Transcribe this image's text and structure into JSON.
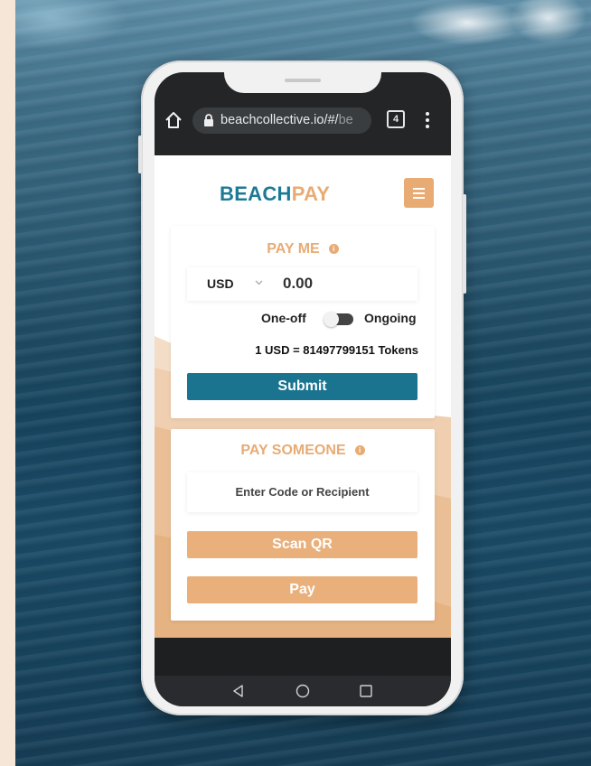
{
  "browser": {
    "url_main": "beachcollective.io/#/",
    "url_faded": "be",
    "tab_count": "4"
  },
  "app": {
    "logo_part1": "BEACH",
    "logo_part2": "PAY"
  },
  "pay_me": {
    "title": "PAY ME",
    "currency": "USD",
    "amount": "0.00",
    "toggle_left": "One-off",
    "toggle_right": "Ongoing",
    "toggle_state": "ongoing",
    "rate": "1 USD = 81497799151 Tokens",
    "submit_label": "Submit"
  },
  "pay_someone": {
    "title": "PAY SOMEONE",
    "recipient_placeholder": "Enter Code or Recipient",
    "scan_label": "Scan QR",
    "pay_label": "Pay"
  },
  "colors": {
    "brand_teal": "#1a7490",
    "brand_sand": "#e8ab74",
    "page_bg": "#f6e6d7"
  },
  "icons": [
    "home-icon",
    "lock-icon",
    "tabs-icon",
    "more-vert-icon",
    "menu-icon",
    "info-icon",
    "chevron-down-icon",
    "back-icon",
    "home-circle-icon",
    "recents-icon"
  ]
}
